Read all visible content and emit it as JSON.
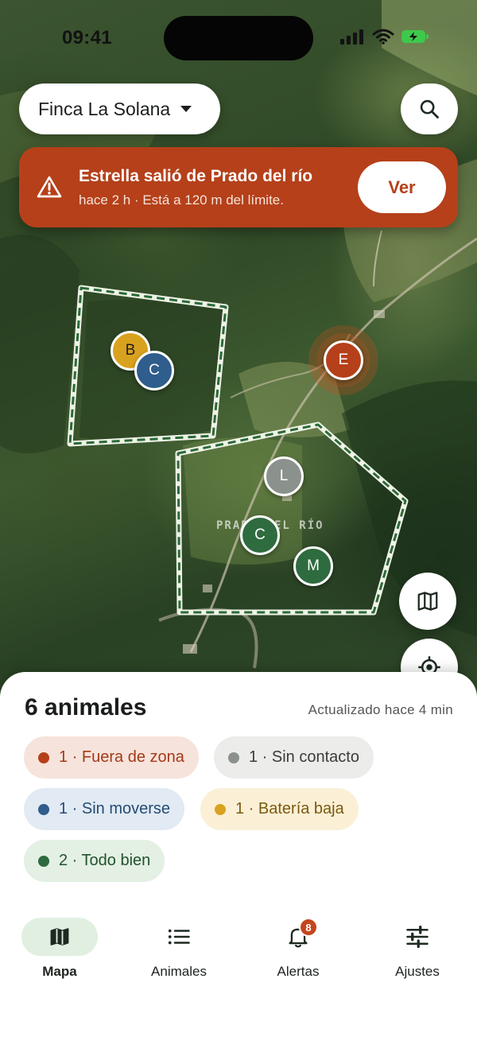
{
  "status_bar": {
    "time": "09:41"
  },
  "farm_selector": {
    "name": "Finca La Solana",
    "icon": "caret-down-icon"
  },
  "search": {
    "icon": "search-icon"
  },
  "alert": {
    "icon": "warning-icon",
    "title": "Estrella salió de Prado del río",
    "subtitle": "hace 2 h · Está a 120 m del límite.",
    "action_label": "Ver"
  },
  "map": {
    "zone_label": "PRADO DEL RÍO",
    "markers": [
      {
        "letter": "B",
        "status": "battery-low",
        "color": "#d9a21e",
        "text_color": "#1d1d1d"
      },
      {
        "letter": "C",
        "status": "not-moving",
        "color": "#2f5d8c",
        "text_color": "#ffffff"
      },
      {
        "letter": "E",
        "status": "out-of-zone",
        "color": "#b5401a",
        "text_color": "#ffffff"
      },
      {
        "letter": "L",
        "status": "no-contact",
        "color": "#8b918c",
        "text_color": "#ffffff"
      },
      {
        "letter": "C",
        "status": "all-good",
        "color": "#2e6b3e",
        "text_color": "#ffffff"
      },
      {
        "letter": "M",
        "status": "all-good",
        "color": "#2e6b3e",
        "text_color": "#ffffff"
      }
    ],
    "layers_button_icon": "map-icon",
    "locate_button_icon": "locate-icon"
  },
  "sheet": {
    "title": "6 animales",
    "updated": "Actualizado hace 4 min",
    "chips": [
      {
        "label": "1 · Fuera de zona",
        "dot": "#b5401a",
        "bg": "#f6e3db",
        "text": "#a33a17"
      },
      {
        "label": "1 · Sin contacto",
        "dot": "#8b918c",
        "bg": "#ececea",
        "text": "#3a3d3b"
      },
      {
        "label": "1 · Sin moverse",
        "dot": "#2f5d8c",
        "bg": "#e2eaf3",
        "text": "#244b73"
      },
      {
        "label": "1 · Batería baja",
        "dot": "#d9a21e",
        "bg": "#fbf0d6",
        "text": "#7a5a0e"
      },
      {
        "label": "2 · Todo bien",
        "dot": "#2e6b3e",
        "bg": "#e3f0e3",
        "text": "#24512f"
      }
    ]
  },
  "tabs": [
    {
      "label": "Mapa",
      "icon": "map-icon",
      "active": true
    },
    {
      "label": "Animales",
      "icon": "list-icon",
      "active": false
    },
    {
      "label": "Alertas",
      "icon": "bell-icon",
      "active": false,
      "badge": "8"
    },
    {
      "label": "Ajustes",
      "icon": "sliders-icon",
      "active": false
    }
  ]
}
